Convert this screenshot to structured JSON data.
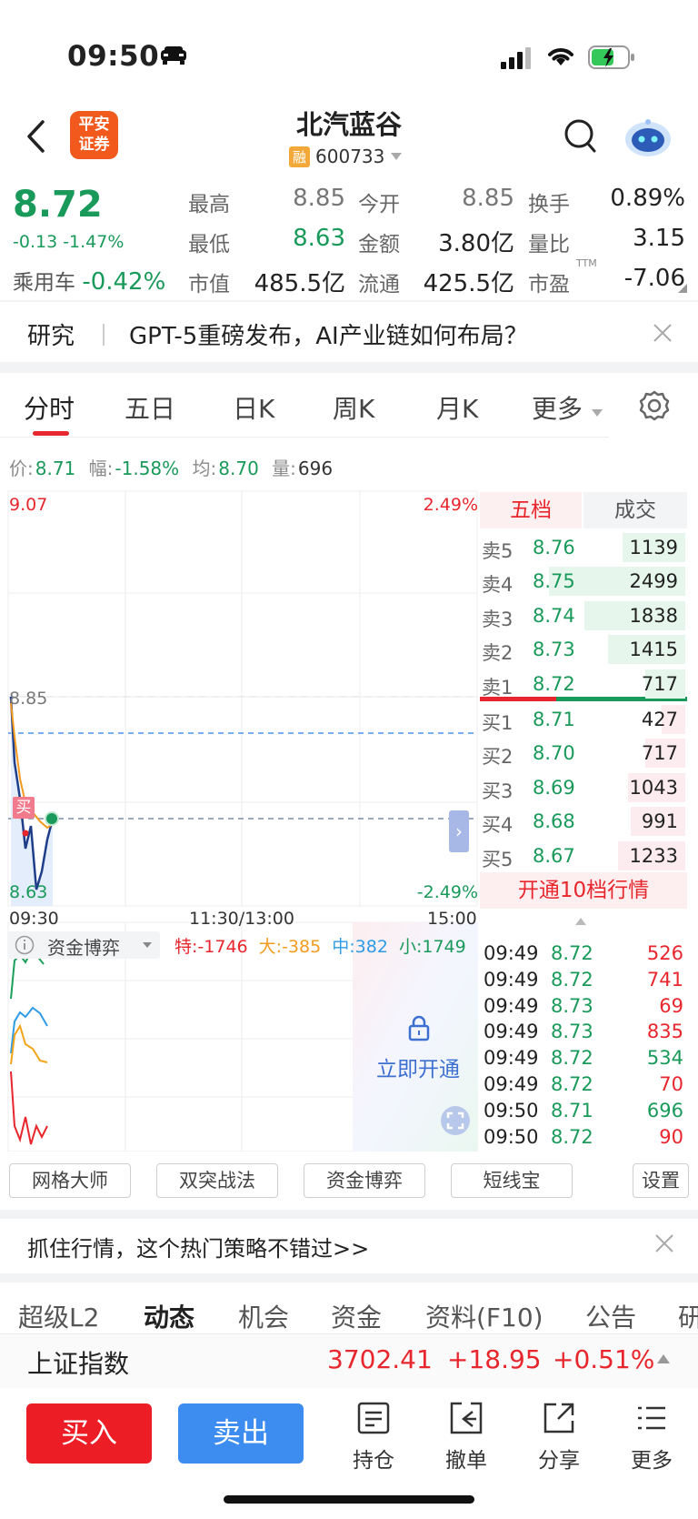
{
  "status_bar": {
    "time": "09:50"
  },
  "header": {
    "title": "北汽蓝谷",
    "code": "600733",
    "margin_badge": "融",
    "logo_text_1": "平安",
    "logo_text_2": "证券"
  },
  "quote": {
    "price": "8.72",
    "change": "-0.13 -1.47%",
    "sector_name": "乘用车",
    "sector_change": "-0.42%",
    "stats": [
      {
        "label": "最高",
        "value": "8.85"
      },
      {
        "label": "今开",
        "value": "8.85"
      },
      {
        "label": "换手",
        "value": "0.89%"
      },
      {
        "label": "最低",
        "value": "8.63"
      },
      {
        "label": "金额",
        "value": "3.80亿"
      },
      {
        "label": "量比",
        "value": "3.15"
      },
      {
        "label": "市值",
        "value": "485.5亿"
      },
      {
        "label": "流通",
        "value": "425.5亿"
      },
      {
        "label": "市盈",
        "value": "-7.06"
      }
    ],
    "pe_superscript": "TTM"
  },
  "news": {
    "tag": "研究",
    "text": "GPT-5重磅发布，AI产业链如何布局？"
  },
  "chart_tabs": [
    "分时",
    "五日",
    "日K",
    "周K",
    "月K",
    "更多"
  ],
  "info_row": {
    "price_label": "价:",
    "price": "8.71",
    "range_label": "幅:",
    "range": "-1.58%",
    "avg_label": "均:",
    "avg": "8.70",
    "vol_label": "量:",
    "vol": "696"
  },
  "chart": {
    "y_top": "9.07",
    "y_top_pct": "2.49%",
    "y_high": "8.85",
    "y_low": "8.63",
    "y_bottom_pct": "-2.49%",
    "x_start": "09:30",
    "x_mid": "11:30/13:00",
    "x_end": "15:00",
    "buy_marker": "买"
  },
  "capital": {
    "title": "资金博弈",
    "te_label": "特:",
    "te": "-1746",
    "da_label": "大:",
    "da": "-385",
    "zhong_label": "中:",
    "zhong": "382",
    "xiao_label": "小:",
    "xiao": "1749",
    "unlock": "立即开通"
  },
  "order_book": {
    "tab_active": "五档",
    "tab_other": "成交",
    "sells": [
      {
        "label": "卖5",
        "price": "8.76",
        "vol": "1139",
        "ratio": 0.46
      },
      {
        "label": "卖4",
        "price": "8.75",
        "vol": "2499",
        "ratio": 1.0
      },
      {
        "label": "卖3",
        "price": "8.74",
        "vol": "1838",
        "ratio": 0.74
      },
      {
        "label": "卖2",
        "price": "8.73",
        "vol": "1415",
        "ratio": 0.57
      },
      {
        "label": "卖1",
        "price": "8.72",
        "vol": "717",
        "ratio": 0.29
      }
    ],
    "buys": [
      {
        "label": "买1",
        "price": "8.71",
        "vol": "427",
        "ratio": 0.17
      },
      {
        "label": "买2",
        "price": "8.70",
        "vol": "717",
        "ratio": 0.29
      },
      {
        "label": "买3",
        "price": "8.69",
        "vol": "1043",
        "ratio": 0.42
      },
      {
        "label": "买4",
        "price": "8.68",
        "vol": "991",
        "ratio": 0.4
      },
      {
        "label": "买5",
        "price": "8.67",
        "vol": "1233",
        "ratio": 0.49
      }
    ],
    "upgrade": "开通10档行情"
  },
  "trades": [
    {
      "time": "09:49",
      "price": "8.72",
      "vol": "526",
      "side": "up"
    },
    {
      "time": "09:49",
      "price": "8.72",
      "vol": "741",
      "side": "up"
    },
    {
      "time": "09:49",
      "price": "8.73",
      "vol": "69",
      "side": "up"
    },
    {
      "time": "09:49",
      "price": "8.73",
      "vol": "835",
      "side": "up"
    },
    {
      "time": "09:49",
      "price": "8.72",
      "vol": "534",
      "side": "down"
    },
    {
      "time": "09:49",
      "price": "8.72",
      "vol": "70",
      "side": "up"
    },
    {
      "time": "09:50",
      "price": "8.71",
      "vol": "696",
      "side": "down"
    },
    {
      "time": "09:50",
      "price": "8.72",
      "vol": "90",
      "side": "up"
    }
  ],
  "strategy_buttons": [
    "网格大师",
    "双突战法",
    "资金博弈",
    "短线宝",
    "设置"
  ],
  "promo": {
    "text": "抓住行情，这个热门策略不错过>>"
  },
  "bottom_tabs": [
    "超级L2",
    "动态",
    "机会",
    "资金",
    "资料(F10)",
    "公告",
    "研"
  ],
  "index": {
    "name": "上证指数",
    "value": "3702.41",
    "change": "+18.95",
    "pct": "+0.51%"
  },
  "actions": {
    "buy": "买入",
    "sell": "卖出",
    "holdings": "持仓",
    "cancel": "撤单",
    "share": "分享",
    "more": "更多"
  },
  "colors": {
    "up": "#e8262d",
    "down": "#1a9a5a",
    "accent_blue": "#3d8cf0"
  }
}
